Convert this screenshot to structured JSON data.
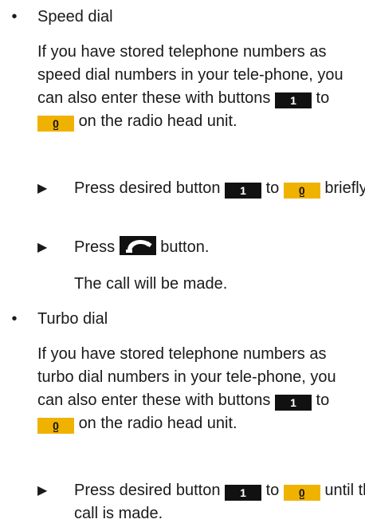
{
  "sections": [
    {
      "bullet": "•",
      "title": "Speed dial",
      "intro": {
        "before_key1": "If you have stored telephone numbers as speed dial numbers in your tele-phone, you can also enter these with buttons",
        "between": "to",
        "after_key2": "on the radio head unit."
      },
      "step1": {
        "arrow": "▶",
        "before": "Press desired button",
        "between": "to",
        "after": "briefly."
      },
      "step2": {
        "arrow": "▶",
        "before": "Press",
        "after": "button."
      },
      "result": "The call will be made."
    },
    {
      "bullet": "•",
      "title": "Turbo dial",
      "intro": {
        "before_key1": "If you have stored telephone numbers as turbo dial numbers in your tele-phone, you can also enter these with buttons",
        "between": "to",
        "after_key2": "on the radio head unit."
      },
      "step1": {
        "arrow": "▶",
        "before": "Press desired button",
        "between": "to",
        "after": "until the call is made."
      }
    }
  ],
  "keys": {
    "one": "1",
    "zero": "0",
    "zero_sub": "␣",
    "phone_icon": "phone-handset-icon",
    "dark_color": "#111111",
    "gold_color": "#f0b200"
  }
}
